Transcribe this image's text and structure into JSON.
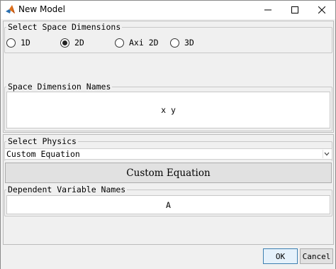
{
  "window": {
    "title": "New Model",
    "app_icon": "matlab-icon",
    "controls": [
      "minimize-icon",
      "maximize-icon",
      "close-icon"
    ]
  },
  "space_dimensions": {
    "legend": "Select Space Dimensions",
    "options": [
      {
        "label": "1D",
        "selected": false
      },
      {
        "label": "2D",
        "selected": true
      },
      {
        "label": "Axi 2D",
        "selected": false
      },
      {
        "label": "3D",
        "selected": false
      }
    ]
  },
  "dimension_names": {
    "legend": "Space Dimension Names",
    "value": "x y"
  },
  "physics": {
    "legend": "Select Physics",
    "selected": "Custom Equation",
    "button_label": "Custom Equation"
  },
  "dependent_variables": {
    "legend": "Dependent Variable Names",
    "value": "A"
  },
  "footer": {
    "ok_label": "OK",
    "cancel_label": "Cancel"
  },
  "colors": {
    "window_bg": "#f0f0f0",
    "ok_border": "#3c7fb1",
    "ok_bg": "#e5f1fb"
  }
}
